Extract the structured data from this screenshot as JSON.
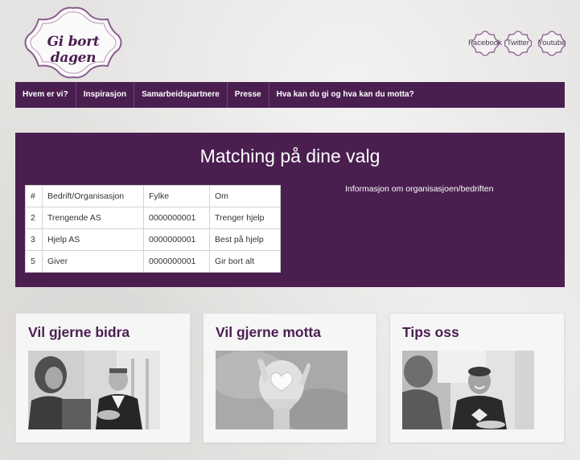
{
  "brand": {
    "logo_text": "Gi bort dagen",
    "accent": "#4a1f50"
  },
  "social": [
    {
      "label": "Facebook"
    },
    {
      "label": "Twitter"
    },
    {
      "label": "Youtube"
    }
  ],
  "nav": [
    {
      "label": "Hvem er vi?"
    },
    {
      "label": "Inspirasjon"
    },
    {
      "label": "Samarbeidspartnere"
    },
    {
      "label": "Presse"
    },
    {
      "label": "Hva kan du gi og hva kan du motta?"
    }
  ],
  "matching": {
    "title": "Matching på dine valg",
    "headers": [
      "#",
      "Bedrift/Organisasjon",
      "Fylke",
      "Om"
    ],
    "rows": [
      [
        "2",
        "Trengende AS",
        "0000000001",
        "Trenger hjelp"
      ],
      [
        "3",
        "Hjelp AS",
        "0000000001",
        "Best på hjelp"
      ],
      [
        "5",
        "Giver",
        "0000000001",
        "Gir bort alt"
      ]
    ],
    "info": "Informasjon om organisasjoen/bedriften"
  },
  "cards": [
    {
      "title": "Vil gjerne bidra",
      "image": "two-people-talking-photo"
    },
    {
      "title": "Vil gjerne motta",
      "image": "heart-in-hand-photo"
    },
    {
      "title": "Tips oss",
      "image": "people-laughing-photo"
    }
  ]
}
